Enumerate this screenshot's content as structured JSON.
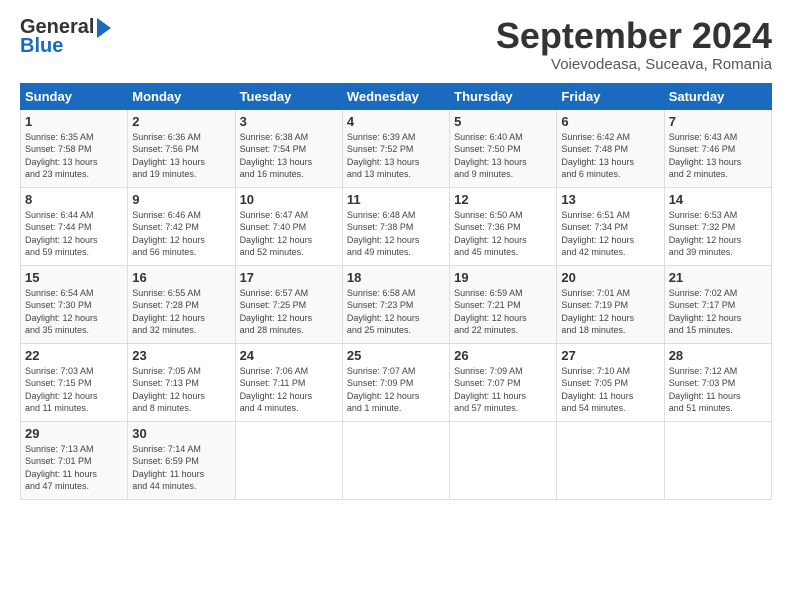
{
  "logo": {
    "general": "General",
    "blue": "Blue"
  },
  "title": "September 2024",
  "subtitle": "Voievodeasa, Suceava, Romania",
  "days_header": [
    "Sunday",
    "Monday",
    "Tuesday",
    "Wednesday",
    "Thursday",
    "Friday",
    "Saturday"
  ],
  "weeks": [
    [
      {
        "day": "1",
        "content": "Sunrise: 6:35 AM\nSunset: 7:58 PM\nDaylight: 13 hours\nand 23 minutes."
      },
      {
        "day": "2",
        "content": "Sunrise: 6:36 AM\nSunset: 7:56 PM\nDaylight: 13 hours\nand 19 minutes."
      },
      {
        "day": "3",
        "content": "Sunrise: 6:38 AM\nSunset: 7:54 PM\nDaylight: 13 hours\nand 16 minutes."
      },
      {
        "day": "4",
        "content": "Sunrise: 6:39 AM\nSunset: 7:52 PM\nDaylight: 13 hours\nand 13 minutes."
      },
      {
        "day": "5",
        "content": "Sunrise: 6:40 AM\nSunset: 7:50 PM\nDaylight: 13 hours\nand 9 minutes."
      },
      {
        "day": "6",
        "content": "Sunrise: 6:42 AM\nSunset: 7:48 PM\nDaylight: 13 hours\nand 6 minutes."
      },
      {
        "day": "7",
        "content": "Sunrise: 6:43 AM\nSunset: 7:46 PM\nDaylight: 13 hours\nand 2 minutes."
      }
    ],
    [
      {
        "day": "8",
        "content": "Sunrise: 6:44 AM\nSunset: 7:44 PM\nDaylight: 12 hours\nand 59 minutes."
      },
      {
        "day": "9",
        "content": "Sunrise: 6:46 AM\nSunset: 7:42 PM\nDaylight: 12 hours\nand 56 minutes."
      },
      {
        "day": "10",
        "content": "Sunrise: 6:47 AM\nSunset: 7:40 PM\nDaylight: 12 hours\nand 52 minutes."
      },
      {
        "day": "11",
        "content": "Sunrise: 6:48 AM\nSunset: 7:38 PM\nDaylight: 12 hours\nand 49 minutes."
      },
      {
        "day": "12",
        "content": "Sunrise: 6:50 AM\nSunset: 7:36 PM\nDaylight: 12 hours\nand 45 minutes."
      },
      {
        "day": "13",
        "content": "Sunrise: 6:51 AM\nSunset: 7:34 PM\nDaylight: 12 hours\nand 42 minutes."
      },
      {
        "day": "14",
        "content": "Sunrise: 6:53 AM\nSunset: 7:32 PM\nDaylight: 12 hours\nand 39 minutes."
      }
    ],
    [
      {
        "day": "15",
        "content": "Sunrise: 6:54 AM\nSunset: 7:30 PM\nDaylight: 12 hours\nand 35 minutes."
      },
      {
        "day": "16",
        "content": "Sunrise: 6:55 AM\nSunset: 7:28 PM\nDaylight: 12 hours\nand 32 minutes."
      },
      {
        "day": "17",
        "content": "Sunrise: 6:57 AM\nSunset: 7:25 PM\nDaylight: 12 hours\nand 28 minutes."
      },
      {
        "day": "18",
        "content": "Sunrise: 6:58 AM\nSunset: 7:23 PM\nDaylight: 12 hours\nand 25 minutes."
      },
      {
        "day": "19",
        "content": "Sunrise: 6:59 AM\nSunset: 7:21 PM\nDaylight: 12 hours\nand 22 minutes."
      },
      {
        "day": "20",
        "content": "Sunrise: 7:01 AM\nSunset: 7:19 PM\nDaylight: 12 hours\nand 18 minutes."
      },
      {
        "day": "21",
        "content": "Sunrise: 7:02 AM\nSunset: 7:17 PM\nDaylight: 12 hours\nand 15 minutes."
      }
    ],
    [
      {
        "day": "22",
        "content": "Sunrise: 7:03 AM\nSunset: 7:15 PM\nDaylight: 12 hours\nand 11 minutes."
      },
      {
        "day": "23",
        "content": "Sunrise: 7:05 AM\nSunset: 7:13 PM\nDaylight: 12 hours\nand 8 minutes."
      },
      {
        "day": "24",
        "content": "Sunrise: 7:06 AM\nSunset: 7:11 PM\nDaylight: 12 hours\nand 4 minutes."
      },
      {
        "day": "25",
        "content": "Sunrise: 7:07 AM\nSunset: 7:09 PM\nDaylight: 12 hours\nand 1 minute."
      },
      {
        "day": "26",
        "content": "Sunrise: 7:09 AM\nSunset: 7:07 PM\nDaylight: 11 hours\nand 57 minutes."
      },
      {
        "day": "27",
        "content": "Sunrise: 7:10 AM\nSunset: 7:05 PM\nDaylight: 11 hours\nand 54 minutes."
      },
      {
        "day": "28",
        "content": "Sunrise: 7:12 AM\nSunset: 7:03 PM\nDaylight: 11 hours\nand 51 minutes."
      }
    ],
    [
      {
        "day": "29",
        "content": "Sunrise: 7:13 AM\nSunset: 7:01 PM\nDaylight: 11 hours\nand 47 minutes."
      },
      {
        "day": "30",
        "content": "Sunrise: 7:14 AM\nSunset: 6:59 PM\nDaylight: 11 hours\nand 44 minutes."
      },
      {
        "day": "",
        "content": ""
      },
      {
        "day": "",
        "content": ""
      },
      {
        "day": "",
        "content": ""
      },
      {
        "day": "",
        "content": ""
      },
      {
        "day": "",
        "content": ""
      }
    ]
  ]
}
